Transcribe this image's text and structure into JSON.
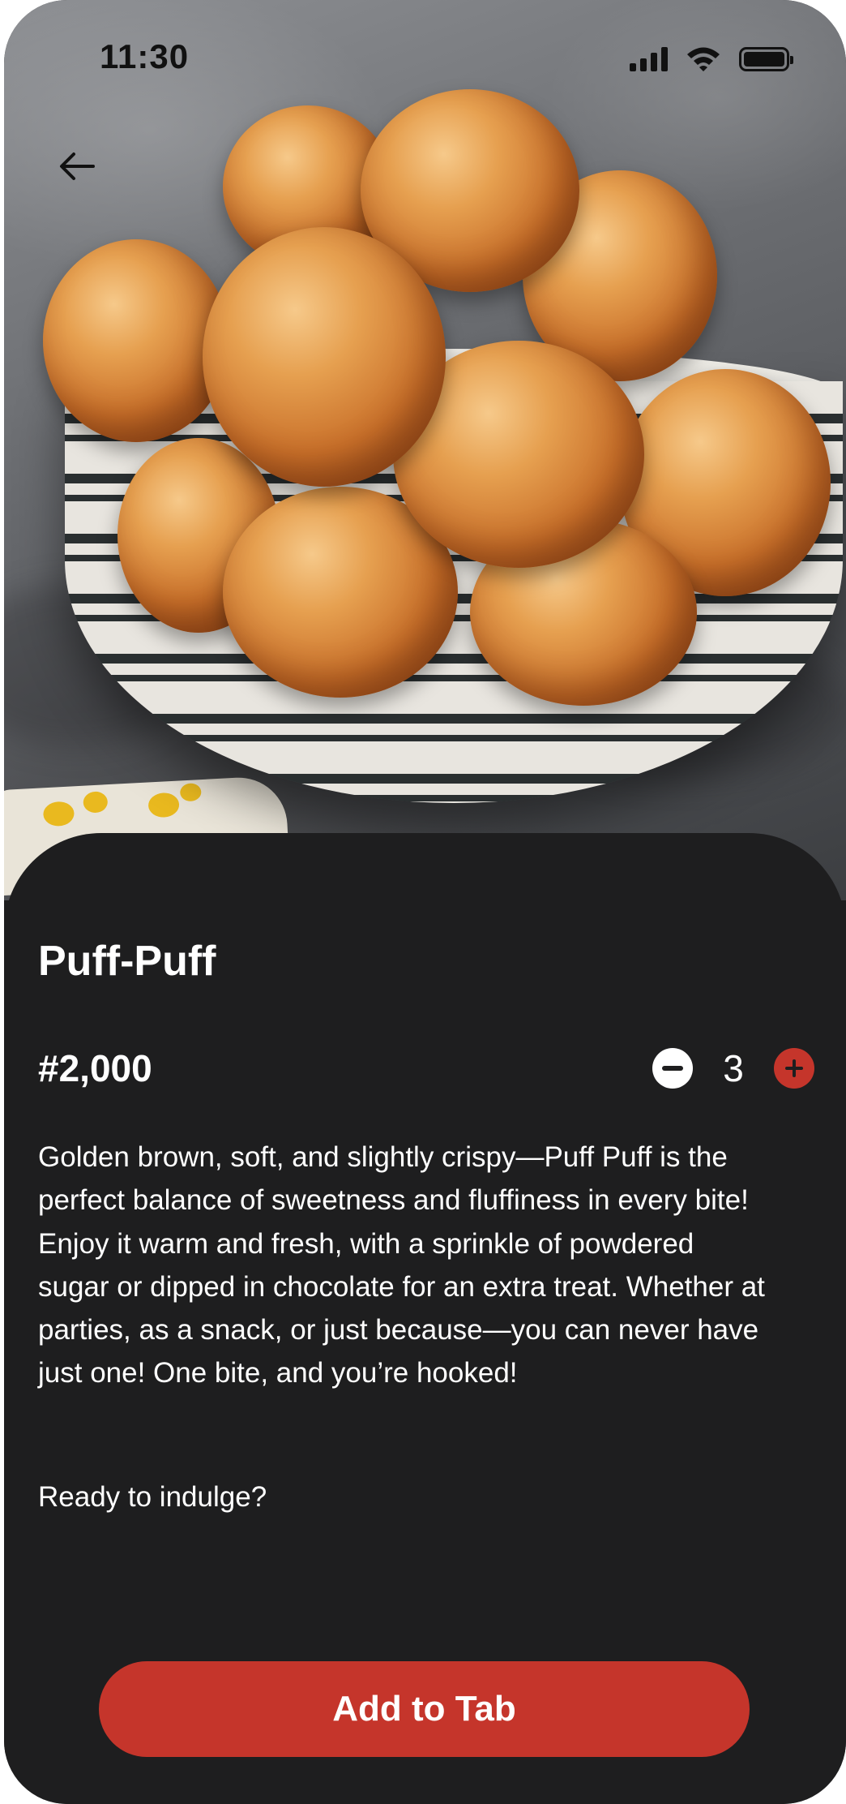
{
  "status_bar": {
    "time": "11:30",
    "icons": [
      "signal-icon",
      "wifi-icon",
      "battery-icon"
    ]
  },
  "nav": {
    "back_icon": "arrow-left-icon"
  },
  "hero_image": {
    "subject": "bowl of puff-puff"
  },
  "product": {
    "name": "Puff-Puff",
    "price": "#2,000",
    "quantity": "3",
    "description": "Golden brown, soft, and slightly crispy—Puff Puff is the perfect balance of sweetness and fluffiness in every bite! Enjoy it warm and fresh, with a sprinkle of powdered sugar or dipped in chocolate for an extra treat. Whether at parties, as a snack, or just because—you can never have just one! One bite, and you’re hooked!",
    "prompt": "Ready to indulge?"
  },
  "actions": {
    "add_label": "Add to Tab"
  },
  "colors": {
    "accent": "#c5352b",
    "sheet_background": "#1e1e1f",
    "text": "#ffffff"
  }
}
